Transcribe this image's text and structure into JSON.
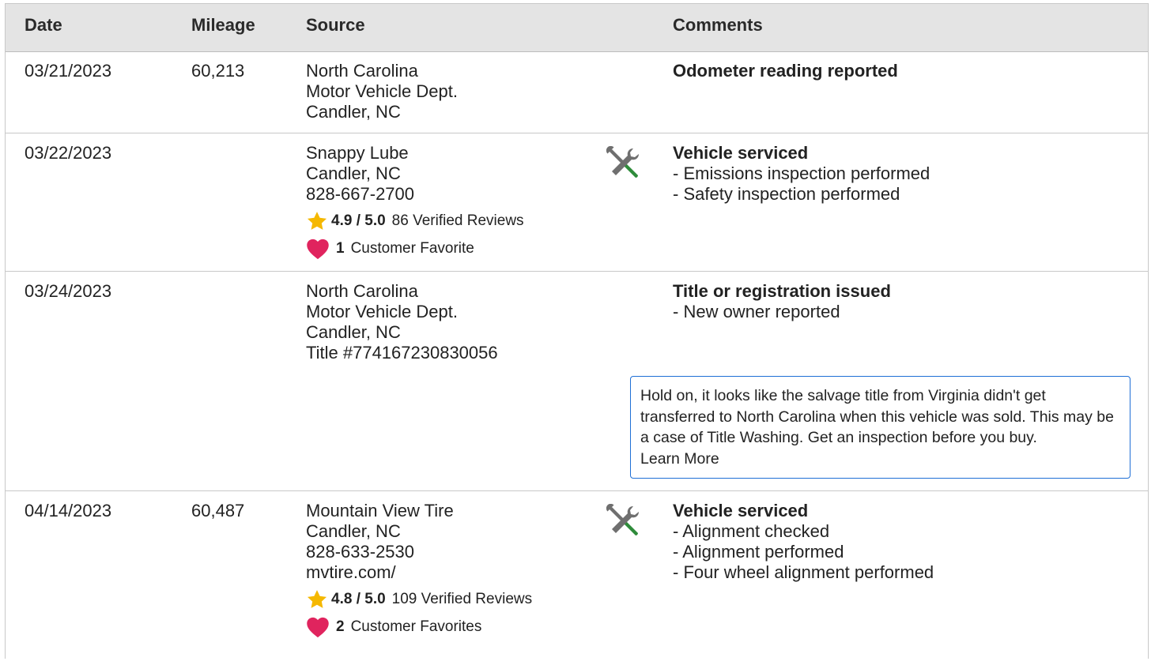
{
  "headers": {
    "date": "Date",
    "mileage": "Mileage",
    "source": "Source",
    "comments": "Comments"
  },
  "rows": [
    {
      "date": "03/21/2023",
      "mileage": "60,213",
      "source": [
        "North Carolina",
        "Motor Vehicle Dept.",
        "Candler, NC"
      ],
      "comment_title": "Odometer reading reported",
      "comment_items": []
    },
    {
      "date": "03/22/2023",
      "mileage": "",
      "source": [
        "Snappy Lube",
        "Candler, NC",
        "828-667-2700"
      ],
      "rating": {
        "score": "4.9 / 5.0",
        "reviews": "86 Verified Reviews"
      },
      "favorites": {
        "count": "1",
        "label": "Customer Favorite"
      },
      "icon": "service-tools-icon",
      "comment_title": "Vehicle serviced",
      "comment_items": [
        "Emissions inspection performed",
        "Safety inspection performed"
      ]
    },
    {
      "date": "03/24/2023",
      "mileage": "",
      "source": [
        "North Carolina",
        "Motor Vehicle Dept.",
        "Candler, NC",
        "Title #774167230830056"
      ],
      "comment_title": "Title or registration issued",
      "comment_items": [
        "New owner reported"
      ],
      "alert": {
        "text": "Hold on, it looks like the salvage title from Virginia didn't get transferred to North Carolina when this vehicle was sold. This may be a case of Title Washing. Get an inspection before you buy.",
        "link": "Learn More"
      }
    },
    {
      "date": "04/14/2023",
      "mileage": "60,487",
      "source": [
        "Mountain View Tire",
        "Candler, NC",
        "828-633-2530",
        "mvtire.com/"
      ],
      "rating": {
        "score": "4.8 / 5.0",
        "reviews": "109 Verified Reviews"
      },
      "favorites": {
        "count": "2",
        "label": "Customer Favorites"
      },
      "icon": "service-tools-icon",
      "comment_title": "Vehicle serviced",
      "comment_items": [
        "Alignment checked",
        "Alignment performed",
        "Four wheel alignment performed"
      ]
    }
  ],
  "colors": {
    "header_bg": "#e4e4e4",
    "star": "#f5b800",
    "heart": "#e0245e",
    "alert_border": "#1f6fd6",
    "wrench_green": "#2e8b3a"
  }
}
